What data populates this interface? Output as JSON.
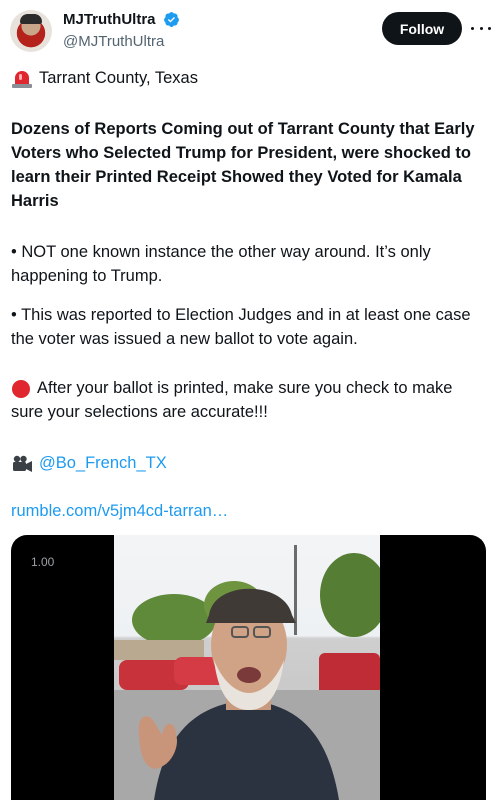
{
  "author": {
    "display_name": "MJTruthUltra",
    "handle": "@MJTruthUltra",
    "verified_icon": "verified-badge-icon",
    "follow_label": "Follow",
    "more_icon": "more-options-icon"
  },
  "tweet": {
    "location": "Tarrant County, Texas",
    "headline": "Dozens of Reports Coming out of Tarrant County that Early Voters who Selected Trump for President, were shocked to learn their Printed Receipt Showed they Voted for Kamala Harris",
    "bullet_1": "• NOT one known instance the other way around. It’s only happening to Trump.",
    "bullet_2": "• This was reported to Election Judges and in at least one case the voter was issued a new ballot to vote again.",
    "warning": "After your ballot is printed, make sure you check to make sure your selections are accurate!!!",
    "credit_mention": "@Bo_French_TX",
    "link": "rumble.com/v5jm4cd-tarran…"
  },
  "video": {
    "playback_speed": "1.00"
  },
  "colors": {
    "accent": "#1d9bf0",
    "text": "#0f1419",
    "muted": "#536471"
  }
}
